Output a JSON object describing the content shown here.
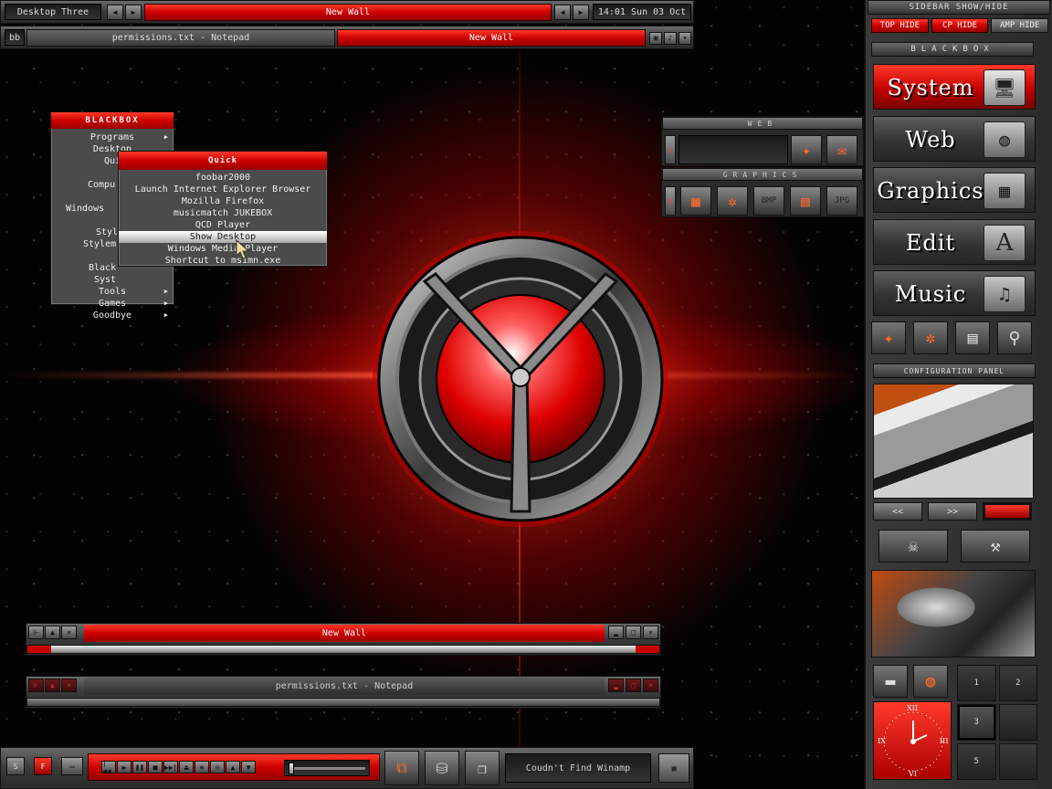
{
  "colors": {
    "accent": "#d40000",
    "accent_light": "#ff3a2a",
    "metal": "#4a4a4a",
    "bg": "#030303"
  },
  "toolbar": {
    "workspace": "Desktop Three",
    "window_title": "New Wall",
    "clock": "14:01 Sun 03 Oct"
  },
  "taskbar_top": {
    "start_label": "bb",
    "tasks": [
      {
        "label": "permissions.txt - Notepad",
        "active": false
      },
      {
        "label": "New Wall",
        "active": true
      }
    ]
  },
  "root_menu": {
    "title": "BLACKBOX",
    "items": [
      {
        "label": "Programs",
        "submenu": true
      },
      {
        "label": "Desktop",
        "submenu": false
      },
      {
        "label": "Qui",
        "submenu": false
      },
      {
        "label": "",
        "submenu": false
      },
      {
        "label": "Compu",
        "submenu": false
      },
      {
        "label": "Windows",
        "submenu": false
      },
      {
        "label": "",
        "submenu": false
      },
      {
        "label": "Styl",
        "submenu": false
      },
      {
        "label": "Stylem",
        "submenu": false
      },
      {
        "label": "",
        "submenu": false
      },
      {
        "label": "Black",
        "submenu": false
      },
      {
        "label": "Syst",
        "submenu": false
      },
      {
        "label": "Tools",
        "submenu": true
      },
      {
        "label": "Games",
        "submenu": true
      },
      {
        "label": "Goodbye",
        "submenu": true
      }
    ]
  },
  "quick_menu": {
    "title": "Quick",
    "items": [
      {
        "label": "foobar2000",
        "highlighted": false
      },
      {
        "label": "Launch Internet Explorer Browser",
        "highlighted": false
      },
      {
        "label": "Mozilla Firefox",
        "highlighted": false
      },
      {
        "label": "musicmatch JUKEBOX",
        "highlighted": false
      },
      {
        "label": "QCD Player",
        "highlighted": false
      },
      {
        "label": "Show Desktop",
        "highlighted": true
      },
      {
        "label": "Windows Media Player",
        "highlighted": false
      },
      {
        "label": "Shortcut to msimn.exe",
        "highlighted": false
      }
    ]
  },
  "panels": {
    "web": {
      "title": "WEB"
    },
    "graphics": {
      "title": "GRAPHICS"
    }
  },
  "windows": [
    {
      "title": "New Wall",
      "active": true
    },
    {
      "title": "permissions.txt - Notepad",
      "active": false
    }
  ],
  "sidebar": {
    "header": "SIDEBAR SHOW/HIDE",
    "toggles": [
      "TOP HIDE",
      "CP HIDE",
      "AMP HIDE"
    ],
    "brand": "BLACKBOX",
    "categories": [
      {
        "label": "System",
        "icon": "monitor-icon",
        "active": true
      },
      {
        "label": "Web",
        "icon": "globe-folder-icon",
        "active": false
      },
      {
        "label": "Graphics",
        "icon": "graphics-folder-icon",
        "active": false
      },
      {
        "label": "Edit",
        "icon": "edit-folder-icon",
        "active": false
      },
      {
        "label": "Music",
        "icon": "music-folder-icon",
        "active": false
      }
    ],
    "config_panel": "CONFIGURATION PANEL",
    "prev_label": "<<",
    "next_label": ">>",
    "clock_numerals": [
      "XII",
      "III",
      "VI",
      "IX"
    ],
    "pager": [
      "1",
      "2",
      "3",
      "",
      "5",
      ""
    ]
  },
  "taskbar_bottom": {
    "left_buttons": [
      "S",
      "F"
    ],
    "transport": [
      "|◀◀",
      "▶",
      "❚❚",
      "■",
      "▶▶|",
      "⏏",
      "≡",
      "⊙",
      "▲",
      "▼"
    ],
    "status": "Coudn't Find Winamp"
  }
}
